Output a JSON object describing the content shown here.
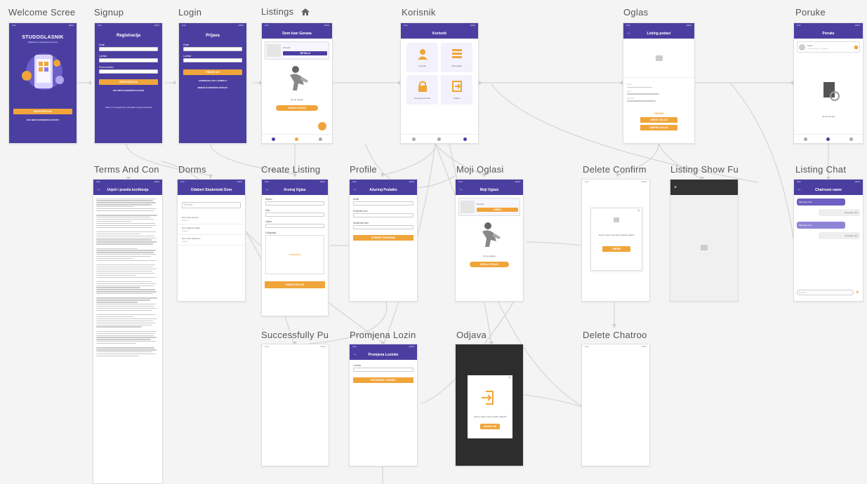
{
  "titles": {
    "welcome": "Welcome Scree",
    "signup": "Signup",
    "login": "Login",
    "listings": "Listings",
    "korisnik": "Korisnik",
    "oglas": "Oglas",
    "poruke": "Poruke",
    "terms": "Terms And Con",
    "dorms": "Dorms",
    "create_listing": "Create Listing",
    "profile": "Profile",
    "moji_oglasi": "Moji Oglasi",
    "delete_confirm": "Delete Confirm",
    "listing_show_fu": "Listing Show Fu",
    "listing_chat": "Listing Chat",
    "successfully": "Successfully Pu",
    "promjena_lozin": "Promjena Lozin",
    "odjava": "Odjava",
    "delete_chatroo": "Delete Chatroo"
  },
  "welcome": {
    "brand": "STUDOGLASNIK",
    "tagline": "Oglasnik za studentske domove",
    "btn_primary": "REGISTRACIJA",
    "btn_secondary": "VEĆ IMAŠ KORISNIČKI RAČUN?"
  },
  "signup": {
    "heading": "Registracija",
    "email_label": "Email",
    "username_label": "Lozinka",
    "password_label": "Ponovi lozinku",
    "btn": "REGISTRACIJA",
    "link": "VEĆ IMAŠ KORISNIČKI RAČUN",
    "footer": "Klikom na 'Registriraj' prihvaćate Uvjete korištenja"
  },
  "login": {
    "heading": "Prijava",
    "email_label": "Email",
    "password_label": "Lozinka",
    "btn": "PRIJAVI SE",
    "link1": "ZABORAVILI STE LOZINKU?",
    "link2": "NEMAŠ KORISNIČKI RAČUN?"
  },
  "listings": {
    "header": "Dom Ivan Gorana",
    "card_title": "Pretraži",
    "card_btn": "DETALJI",
    "empty": "Nema oglasa",
    "add_btn": "DODAJ OGLAS"
  },
  "korisnik": {
    "header": "Korisnik",
    "tiles": [
      "Korisnik",
      "Moji oglasi",
      "Promjena lozinke",
      "Odjava"
    ]
  },
  "oglas": {
    "header": "Listing podaci",
    "label1": "Naziv",
    "label2": "Opis",
    "label3": "Kontakt",
    "btn1": "PORUKE",
    "btn2": "UREDI OGLAS",
    "btn3": "IZBRIŠI OGLAS"
  },
  "poruke": {
    "header": "Poruke",
    "chat_name": "Ivana",
    "chat_preview": "Imam pitanje o oglasu",
    "empty": "Nema poruka"
  },
  "terms": {
    "header": "Uvjeti i pravila korištenja"
  },
  "dorms": {
    "header": "Odaberi Studentski Dom",
    "search": "Pretraži...",
    "items": [
      "Dom Ivan Gorana",
      "Dom Stjepan Radić",
      "Dom Ante Starčević"
    ],
    "item_sub": "Zagreb"
  },
  "create_listing": {
    "header": "Kreiraj Oglas",
    "label1": "Naslov",
    "label2": "Opis",
    "label3": "Cijena",
    "label4": "Fotografija",
    "upload": "Dodaj sliku",
    "btn": "OBJAVI OGLAS"
  },
  "profile": {
    "header": "Ažuriraj Podatke",
    "label1": "Email",
    "label2": "Korisničko ime",
    "label3": "Studentski dom",
    "btn": "SPREMI PROMJENE"
  },
  "moji_oglasi": {
    "header": "Moji Oglasi",
    "card_title": "Pretraži",
    "card_btn": "UREDI",
    "empty": "Nema oglasa",
    "add_btn": "DODAJ OGLAS"
  },
  "delete_confirm": {
    "text": "Jeste li sigurni da želite obrisati oglas?",
    "btn": "OBRIŠI"
  },
  "listing_chat": {
    "header": "Chatroom name",
    "msg1": "Message Text",
    "msg2": "Message Text",
    "msg3": "Message Text",
    "msg4": "Message Text",
    "input": "Poruka..."
  },
  "promjena": {
    "header": "Promjena Lozinke",
    "label": "Lozinka",
    "btn": "PROMIJENI LOZINKU"
  },
  "odjava": {
    "text": "Jeste li sigurni da se želite odjaviti?",
    "btn": "ODJAVI SE"
  },
  "colors": {
    "primary": "#4a3fa1",
    "accent": "#f0a53a",
    "canvas": "#f4f4f4",
    "wire": "#d2d2d2"
  }
}
